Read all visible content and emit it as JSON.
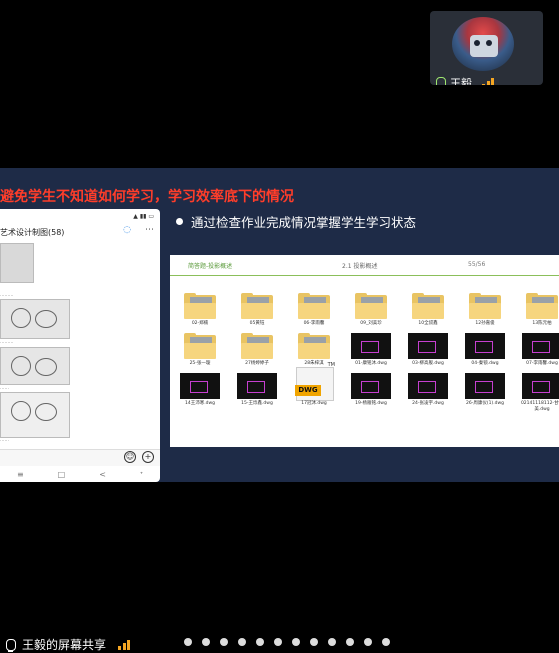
{
  "participant": {
    "name": "王毅",
    "mic_color": "#9fe870",
    "signal_color": "#f5a623"
  },
  "slide": {
    "title": "避免学生不知道如何学习，学习效率底下的情况",
    "title_color": "#ff3d2a",
    "bullet": "通过检查作业完成情况掌握学生学习状态"
  },
  "phone": {
    "title": "艺术设计制图(58)",
    "more_icon": "⋯",
    "nav": [
      "≡",
      "□",
      "<",
      "ᐩ"
    ]
  },
  "browser": {
    "breadcrumb_left": "简答题-投影概述",
    "breadcrumb_mid": "2.1 投影概述",
    "page": "55/56",
    "files": [
      {
        "name": "02-郑楠",
        "icon": "folder"
      },
      {
        "name": "05黄钰",
        "icon": "folder"
      },
      {
        "name": "06-李雨馨",
        "icon": "folder"
      },
      {
        "name": "09_刘美珍",
        "icon": "folder"
      },
      {
        "name": "10全叔鑫",
        "icon": "folder"
      },
      {
        "name": "12孙嘉俊",
        "icon": "folder"
      },
      {
        "name": "13陈元柏",
        "icon": "folder"
      },
      {
        "name": "25-张一璇",
        "icon": "folder"
      },
      {
        "name": "27杨婷婷子",
        "icon": "folder"
      },
      {
        "name": "28朱梓淇",
        "icon": "folder"
      },
      {
        "name": "01-康铭沐.dwg",
        "icon": "dwg-thumb"
      },
      {
        "name": "03-柳高舰.dwg",
        "icon": "dwg-thumb"
      },
      {
        "name": "04-秦锁.dwg",
        "icon": "dwg-thumb"
      },
      {
        "name": "07-李雨馨.dwg",
        "icon": "dwg-thumb"
      },
      {
        "name": "14王沛寒.dwg",
        "icon": "dwg-thumb"
      },
      {
        "name": "15-王烁鑫.dwg",
        "icon": "dwg-thumb"
      },
      {
        "name": "17冠沐.dwg",
        "icon": "dwg-file"
      },
      {
        "name": "19-杨雁铭.dwg",
        "icon": "dwg-thumb"
      },
      {
        "name": "24-张凌宇.dwg",
        "icon": "dwg-thumb"
      },
      {
        "name": "26-周康仪(1).dwg",
        "icon": "dwg-thumb"
      },
      {
        "name": "02141118112-甘健美.dwg",
        "icon": "dwg-thumb"
      }
    ],
    "dwg_label": "DWG",
    "tm": "TM"
  },
  "sharebar": {
    "text": "王毅的屏幕共享"
  }
}
